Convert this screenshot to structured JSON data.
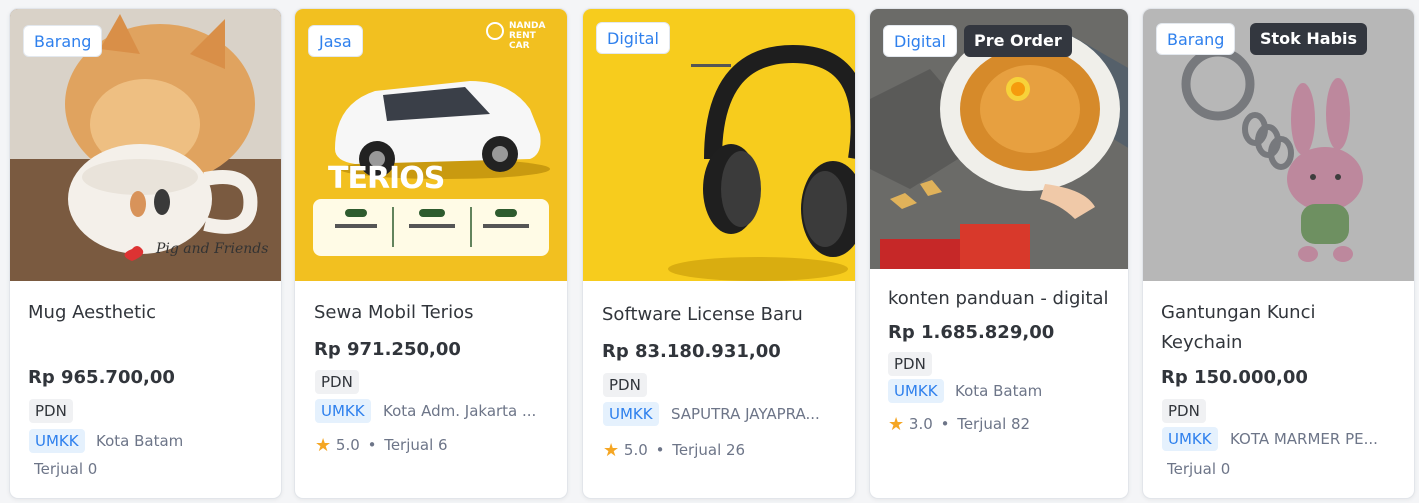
{
  "colors": {
    "accent": "#2f80ed",
    "star": "#f5a623",
    "text": "#31353b",
    "muted": "#6d7588"
  },
  "products": [
    {
      "type": "Barang",
      "title": "Mug Aesthetic",
      "price": "Rp 965.700,00",
      "tag_pdn": "PDN",
      "tag_umkk": "UMKK",
      "location": "Kota Batam",
      "sold": "Terjual 0",
      "image_text": "Pig and Friends",
      "image_icon": "mug-cat-photo"
    },
    {
      "type": "Jasa",
      "title": "Sewa Mobil Terios",
      "price": "Rp 971.250,00",
      "tag_pdn": "PDN",
      "tag_umkk": "UMKK",
      "location": "Kota Adm. Jakarta ...",
      "rating": "5.0",
      "sold": "Terjual 6",
      "image_brand": "NANDA RENT CAR",
      "image_text": "TERIOS",
      "image_icon": "car-rental-photo"
    },
    {
      "type": "Digital",
      "title": "Software License Baru",
      "price": "Rp 83.180.931,00",
      "tag_pdn": "PDN",
      "tag_umkk": "UMKK",
      "location": "SAPUTRA JAYAPRA...",
      "rating": "5.0",
      "sold": "Terjual 26",
      "image_icon": "headphones-photo"
    },
    {
      "type": "Digital",
      "status": "Pre Order",
      "title": "konten panduan - digital",
      "price": "Rp 1.685.829,00",
      "tag_pdn": "PDN",
      "tag_umkk": "UMKK",
      "location": "Kota Batam",
      "rating": "3.0",
      "sold": "Terjual 82",
      "image_icon": "noodles-photo"
    },
    {
      "type": "Barang",
      "status": "Stok Habis",
      "title": "Gantungan Kunci Keychain",
      "price": "Rp 150.000,00",
      "tag_pdn": "PDN",
      "tag_umkk": "UMKK",
      "location": "KOTA MARMER PE...",
      "sold": "Terjual 0",
      "image_icon": "keychain-photo"
    }
  ]
}
